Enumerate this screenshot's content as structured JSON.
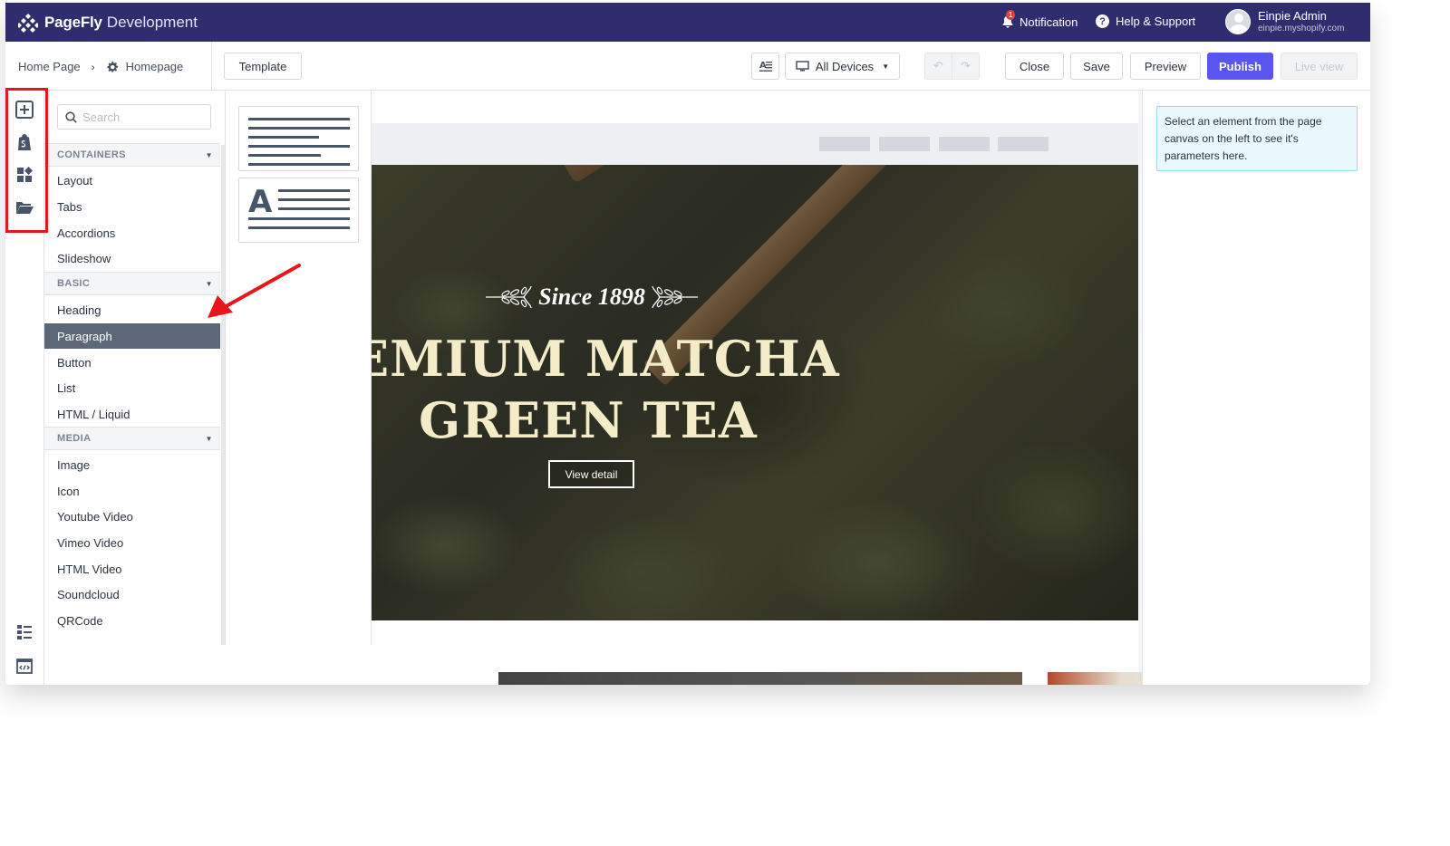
{
  "header": {
    "brand": "PageFly",
    "app_suffix": "Development",
    "notification_label": "Notification",
    "notification_count": "1",
    "help_label": "Help & Support",
    "user_name": "Einpie Admin",
    "user_shop": "einpie.myshopify.com"
  },
  "toolbar": {
    "breadcrumb_root": "Home Page",
    "breadcrumb_sep": "›",
    "page_name": "Homepage",
    "template_label": "Template",
    "device_label": "All Devices",
    "undo_glyph": "↶",
    "redo_glyph": "↷",
    "close_label": "Close",
    "save_label": "Save",
    "preview_label": "Preview",
    "publish_label": "Publish",
    "live_view_label": "Live view"
  },
  "elements_panel": {
    "search_placeholder": "Search",
    "categories": [
      {
        "name": "CONTAINERS",
        "items": [
          "Layout",
          "Tabs",
          "Accordions",
          "Slideshow"
        ]
      },
      {
        "name": "BASIC",
        "items": [
          "Heading",
          "Paragraph",
          "Button",
          "List",
          "HTML / Liquid"
        ]
      },
      {
        "name": "MEDIA",
        "items": [
          "Image",
          "Icon",
          "Youtube Video",
          "Vimeo Video",
          "HTML Video",
          "Soundcloud",
          "QRCode"
        ]
      }
    ],
    "selected_item": "Paragraph"
  },
  "canvas": {
    "tagline": "Since 1898",
    "headline_line1": "EMIUM MATCHA",
    "headline_line2": "GREEN TEA",
    "cta_label": "View detail"
  },
  "right_panel": {
    "hint": "Select an element from the page canvas on the left to see it's parameters here."
  },
  "colors": {
    "header_bg": "#2f2d6e",
    "publish": "#5b55f0",
    "active_item": "#5c6879",
    "highlight": "#e8151c",
    "info_bg": "#e8f8fc"
  },
  "icons": {
    "rail": [
      "add-element-icon",
      "shopify-bag-icon",
      "sections-icon",
      "folder-icon",
      "layers-icon",
      "code-icon"
    ]
  }
}
